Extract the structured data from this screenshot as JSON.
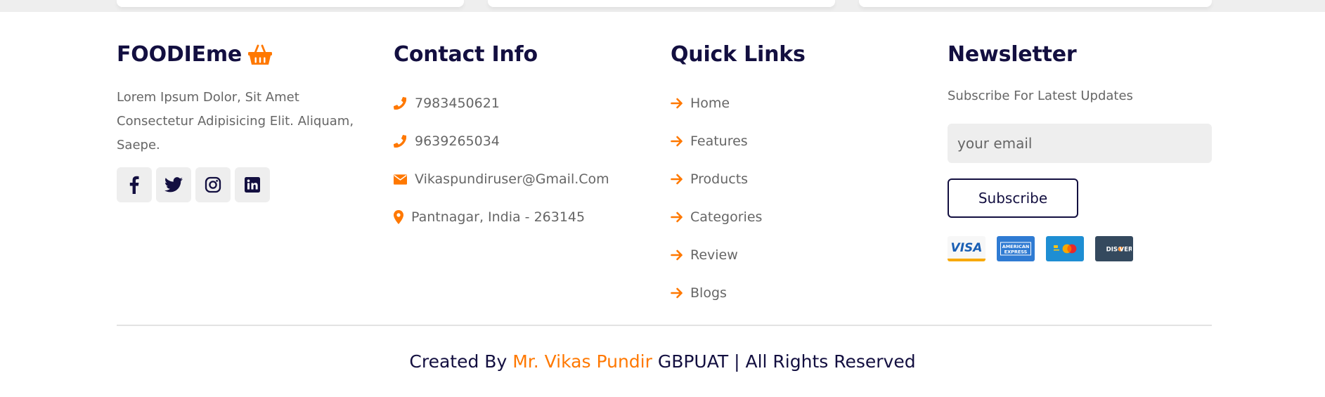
{
  "colors": {
    "accent": "#ff7800",
    "heading": "#130f40",
    "text": "#666666",
    "muted_bg": "#eeeeee"
  },
  "brand": {
    "name": "FOODIEme",
    "icon": "shopping-basket-icon",
    "description": "Lorem Ipsum Dolor, Sit Amet Consectetur Adipisicing Elit. Aliquam, Saepe.",
    "socials": [
      {
        "name": "facebook-icon"
      },
      {
        "name": "twitter-icon"
      },
      {
        "name": "instagram-icon"
      },
      {
        "name": "linkedin-icon"
      }
    ]
  },
  "contact": {
    "title": "Contact Info",
    "items": [
      {
        "icon": "phone-icon",
        "text": "7983450621"
      },
      {
        "icon": "phone-icon",
        "text": "9639265034"
      },
      {
        "icon": "envelope-icon",
        "text": "Vikaspundiruser@Gmail.Com"
      },
      {
        "icon": "map-marker-icon",
        "text": "Pantnagar, India - 263145"
      }
    ]
  },
  "quick_links": {
    "title": "Quick Links",
    "icon": "arrow-right-icon",
    "items": [
      {
        "label": "Home"
      },
      {
        "label": "Features"
      },
      {
        "label": "Products"
      },
      {
        "label": "Categories"
      },
      {
        "label": "Review"
      },
      {
        "label": "Blogs"
      }
    ]
  },
  "newsletter": {
    "title": "Newsletter",
    "subtitle": "Subscribe For Latest Updates",
    "email_placeholder": "your email",
    "subscribe_label": "Subscribe",
    "payment_cards": [
      "visa-card-icon",
      "american-express-card-icon",
      "mastercard-icon",
      "discover-card-icon"
    ]
  },
  "footer": {
    "credit_prefix": "Created By ",
    "credit_author": "Mr. Vikas Pundir",
    "credit_suffix": " GBPUAT | All Rights Reserved"
  }
}
